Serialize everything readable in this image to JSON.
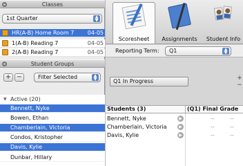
{
  "classes": {
    "header": "Classes",
    "quarter_select": "1st Quarter",
    "items": [
      {
        "name": "HR(A-B) Home Room 7",
        "term": "04-05",
        "selected": true
      },
      {
        "name": "1(A-B) Reading 7",
        "term": "04-05",
        "selected": false
      },
      {
        "name": "2(A-B) Reading 7",
        "term": "04-05",
        "selected": false
      }
    ]
  },
  "student_groups": {
    "header": "Student Groups",
    "add_label": "+",
    "remove_label": "−",
    "filter_select": "Filter Selected",
    "group_label": "Active (20)",
    "students": [
      {
        "name": "Bennett, Nyke",
        "selected": true
      },
      {
        "name": "Bowen, Ethan",
        "selected": false
      },
      {
        "name": "Chamberlain, Victoria",
        "selected": true
      },
      {
        "name": "Condos, Kristopher",
        "selected": false
      },
      {
        "name": "Davis, Kylie",
        "selected": true
      },
      {
        "name": "Dunbar, Hillary",
        "selected": false
      }
    ]
  },
  "tabs": {
    "scoresheet": "Scoresheet",
    "assignments": "Assignments",
    "student_info": "Student Info"
  },
  "reporting": {
    "label": "Reporting Term:",
    "value": "Q1"
  },
  "progress_button": "Q1 In Progress",
  "side_add": "+",
  "side_remove": "−",
  "table": {
    "col_students": "Students (3)",
    "col_grade": "(Q1) Final Grade",
    "rows": [
      {
        "name": "Bennett, Nyke",
        "v1": "--",
        "v2": "--"
      },
      {
        "name": "Chamberlain, Victoria",
        "v1": "--",
        "v2": "--"
      },
      {
        "name": "Davis, Kylie",
        "v1": "--",
        "v2": "--"
      }
    ]
  },
  "colors": {
    "selection": "#3c74d6",
    "class_icon": "#e4a12a"
  }
}
